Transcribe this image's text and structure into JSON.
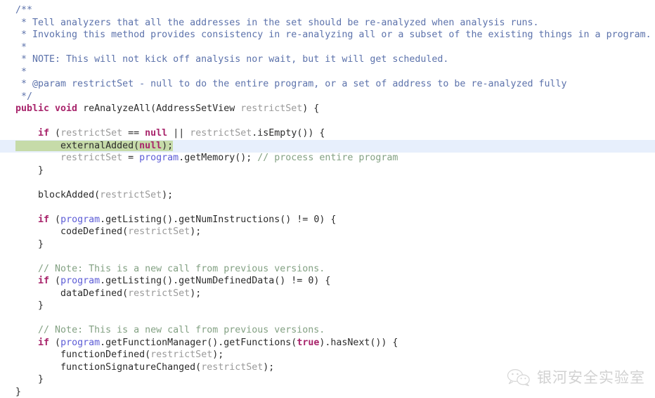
{
  "editor": {
    "background": "#ffffff",
    "caret_line_color": "#e7effc",
    "selection_color": "#c6dba9",
    "language": "java",
    "colors": {
      "doc_comment": "#5c72ab",
      "line_comment": "#83a183",
      "keyword": "#a8246b",
      "identifier": "#2b2b2b",
      "parameter": "#9a9a9a",
      "field": "#5c5cd6"
    }
  },
  "code": {
    "lines": [
      {
        "indent": 0,
        "caret": false,
        "tokens": [
          {
            "t": "/**",
            "c": "cmt-doc"
          }
        ]
      },
      {
        "indent": 0,
        "caret": false,
        "tokens": [
          {
            "t": " * Tell analyzers that all the addresses in the set should be re-analyzed when analysis runs.",
            "c": "cmt-doc"
          }
        ]
      },
      {
        "indent": 0,
        "caret": false,
        "tokens": [
          {
            "t": " * Invoking this method provides consistency in re-analyzing all or a subset of the existing things in a program.",
            "c": "cmt-doc"
          }
        ]
      },
      {
        "indent": 0,
        "caret": false,
        "tokens": [
          {
            "t": " *",
            "c": "cmt-doc"
          }
        ]
      },
      {
        "indent": 0,
        "caret": false,
        "tokens": [
          {
            "t": " * NOTE: This will not kick off analysis nor wait, but it will get scheduled.",
            "c": "cmt-doc"
          }
        ]
      },
      {
        "indent": 0,
        "caret": false,
        "tokens": [
          {
            "t": " *",
            "c": "cmt-doc"
          }
        ]
      },
      {
        "indent": 0,
        "caret": false,
        "tokens": [
          {
            "t": " * @param restrictSet - null to do the entire program, or a set of address to be re-analyzed fully",
            "c": "cmt-doc"
          }
        ]
      },
      {
        "indent": 0,
        "caret": false,
        "tokens": [
          {
            "t": " */",
            "c": "cmt-doc"
          }
        ]
      },
      {
        "indent": 0,
        "caret": false,
        "tokens": [
          {
            "t": "public void",
            "c": "kw"
          },
          {
            "t": " reAnalyzeAll(AddressSetView ",
            "c": "ident"
          },
          {
            "t": "restrictSet",
            "c": "param"
          },
          {
            "t": ") {",
            "c": "punc"
          }
        ]
      },
      {
        "indent": 0,
        "caret": false,
        "tokens": [
          {
            "t": "",
            "c": "ident"
          }
        ]
      },
      {
        "indent": 2,
        "caret": false,
        "tokens": [
          {
            "t": "if",
            "c": "kw"
          },
          {
            "t": " (",
            "c": "punc"
          },
          {
            "t": "restrictSet",
            "c": "param"
          },
          {
            "t": " == ",
            "c": "punc"
          },
          {
            "t": "null",
            "c": "kw"
          },
          {
            "t": " || ",
            "c": "punc"
          },
          {
            "t": "restrictSet",
            "c": "param"
          },
          {
            "t": ".isEmpty()) {",
            "c": "ident"
          }
        ]
      },
      {
        "indent": 4,
        "caret": true,
        "highlight": true,
        "tokens": [
          {
            "t": "externalAdded(",
            "c": "ident"
          },
          {
            "t": "null",
            "c": "kw"
          },
          {
            "t": ");",
            "c": "punc"
          }
        ]
      },
      {
        "indent": 4,
        "caret": false,
        "tokens": [
          {
            "t": "restrictSet",
            "c": "param"
          },
          {
            "t": " = ",
            "c": "punc"
          },
          {
            "t": "program",
            "c": "field"
          },
          {
            "t": ".getMemory(); ",
            "c": "ident"
          },
          {
            "t": "// process entire program",
            "c": "cmt-line"
          }
        ]
      },
      {
        "indent": 2,
        "caret": false,
        "tokens": [
          {
            "t": "}",
            "c": "punc"
          }
        ]
      },
      {
        "indent": 0,
        "caret": false,
        "tokens": [
          {
            "t": "",
            "c": "ident"
          }
        ]
      },
      {
        "indent": 2,
        "caret": false,
        "tokens": [
          {
            "t": "blockAdded(",
            "c": "ident"
          },
          {
            "t": "restrictSet",
            "c": "param"
          },
          {
            "t": ");",
            "c": "punc"
          }
        ]
      },
      {
        "indent": 0,
        "caret": false,
        "tokens": [
          {
            "t": "",
            "c": "ident"
          }
        ]
      },
      {
        "indent": 2,
        "caret": false,
        "tokens": [
          {
            "t": "if",
            "c": "kw"
          },
          {
            "t": " (",
            "c": "punc"
          },
          {
            "t": "program",
            "c": "field"
          },
          {
            "t": ".getListing().getNumInstructions() != ",
            "c": "ident"
          },
          {
            "t": "0",
            "c": "num"
          },
          {
            "t": ") {",
            "c": "punc"
          }
        ]
      },
      {
        "indent": 4,
        "caret": false,
        "tokens": [
          {
            "t": "codeDefined(",
            "c": "ident"
          },
          {
            "t": "restrictSet",
            "c": "param"
          },
          {
            "t": ");",
            "c": "punc"
          }
        ]
      },
      {
        "indent": 2,
        "caret": false,
        "tokens": [
          {
            "t": "}",
            "c": "punc"
          }
        ]
      },
      {
        "indent": 0,
        "caret": false,
        "tokens": [
          {
            "t": "",
            "c": "ident"
          }
        ]
      },
      {
        "indent": 2,
        "caret": false,
        "tokens": [
          {
            "t": "// Note: This is a new call from previous versions.",
            "c": "cmt-line"
          }
        ]
      },
      {
        "indent": 2,
        "caret": false,
        "tokens": [
          {
            "t": "if",
            "c": "kw"
          },
          {
            "t": " (",
            "c": "punc"
          },
          {
            "t": "program",
            "c": "field"
          },
          {
            "t": ".getListing().getNumDefinedData() != ",
            "c": "ident"
          },
          {
            "t": "0",
            "c": "num"
          },
          {
            "t": ") {",
            "c": "punc"
          }
        ]
      },
      {
        "indent": 4,
        "caret": false,
        "tokens": [
          {
            "t": "dataDefined(",
            "c": "ident"
          },
          {
            "t": "restrictSet",
            "c": "param"
          },
          {
            "t": ");",
            "c": "punc"
          }
        ]
      },
      {
        "indent": 2,
        "caret": false,
        "tokens": [
          {
            "t": "}",
            "c": "punc"
          }
        ]
      },
      {
        "indent": 0,
        "caret": false,
        "tokens": [
          {
            "t": "",
            "c": "ident"
          }
        ]
      },
      {
        "indent": 2,
        "caret": false,
        "tokens": [
          {
            "t": "// Note: This is a new call from previous versions.",
            "c": "cmt-line"
          }
        ]
      },
      {
        "indent": 2,
        "caret": false,
        "tokens": [
          {
            "t": "if",
            "c": "kw"
          },
          {
            "t": " (",
            "c": "punc"
          },
          {
            "t": "program",
            "c": "field"
          },
          {
            "t": ".getFunctionManager().getFunctions(",
            "c": "ident"
          },
          {
            "t": "true",
            "c": "kw"
          },
          {
            "t": ").hasNext()) {",
            "c": "ident"
          }
        ]
      },
      {
        "indent": 4,
        "caret": false,
        "tokens": [
          {
            "t": "functionDefined(",
            "c": "ident"
          },
          {
            "t": "restrictSet",
            "c": "param"
          },
          {
            "t": ");",
            "c": "punc"
          }
        ]
      },
      {
        "indent": 4,
        "caret": false,
        "tokens": [
          {
            "t": "functionSignatureChanged(",
            "c": "ident"
          },
          {
            "t": "restrictSet",
            "c": "param"
          },
          {
            "t": ");",
            "c": "punc"
          }
        ]
      },
      {
        "indent": 2,
        "caret": false,
        "tokens": [
          {
            "t": "}",
            "c": "punc"
          }
        ]
      },
      {
        "indent": 0,
        "caret": false,
        "tokens": [
          {
            "t": "}",
            "c": "punc"
          }
        ]
      }
    ]
  },
  "watermark": {
    "icon": "wechat-icon",
    "text": "银河安全实验室"
  }
}
